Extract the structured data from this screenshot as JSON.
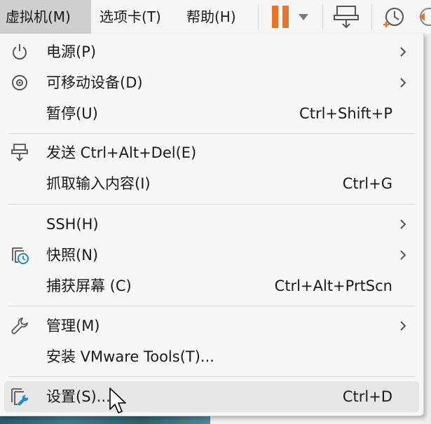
{
  "menubar": {
    "items": [
      {
        "label": "虚拟机(M)"
      },
      {
        "label": "选项卡(T)"
      },
      {
        "label": "帮助(H)"
      }
    ],
    "toolbar_icons": [
      "pause-icon",
      "dropdown-caret-icon",
      "send-ctrl-alt-del-icon",
      "snapshot-icon",
      "revert-icon"
    ],
    "pause_color": "#e8732a"
  },
  "menu": {
    "items": [
      {
        "label": "电源(P)",
        "icon": "power-icon",
        "submenu": true
      },
      {
        "label": "可移动设备(D)",
        "icon": "removable-devices-icon",
        "submenu": true
      },
      {
        "label": "暂停(U)",
        "shortcut": "Ctrl+Shift+P"
      },
      {
        "label": "发送 Ctrl+Alt+Del(E)",
        "icon": "send-keys-icon"
      },
      {
        "label": "抓取输入内容(I)",
        "shortcut": "Ctrl+G"
      },
      {
        "label": "SSH(H)",
        "submenu": true
      },
      {
        "label": "快照(N)",
        "icon": "snapshot-icon",
        "submenu": true
      },
      {
        "label": "捕获屏幕 (C)",
        "shortcut": "Ctrl+Alt+PrtScn"
      },
      {
        "label": "管理(M)",
        "icon": "wrench-icon",
        "submenu": true
      },
      {
        "label": "安装 VMware Tools(T)..."
      },
      {
        "label": "设置(S)...",
        "icon": "settings-icon",
        "shortcut": "Ctrl+D",
        "highlighted": true
      }
    ],
    "accent_color": "#1e88d2"
  }
}
